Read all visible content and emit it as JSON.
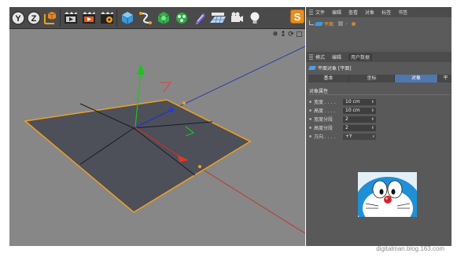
{
  "toolbar": {
    "icons": [
      "y-axis-lock-icon",
      "z-axis-lock-icon",
      "coordinate-system-icon",
      "render-view-icon",
      "render-active-icon",
      "render-settings-icon",
      "cube-primitive-icon",
      "spline-icon",
      "nurbs-icon",
      "modeling-icon",
      "deformer-icon",
      "floor-icon",
      "camera-icon",
      "light-icon"
    ],
    "y_label": "Y",
    "z_label": "Z"
  },
  "viewport": {
    "nav_icons": [
      "✵",
      "↕",
      "⟳",
      "□"
    ]
  },
  "logo": {
    "label": "S"
  },
  "object_manager": {
    "menu": [
      "文件",
      "编辑",
      "查看",
      "对象",
      "标签",
      "书签"
    ],
    "object_name": "平面"
  },
  "attribute_manager": {
    "menu": [
      "模式",
      "编辑",
      "用户数据"
    ],
    "title": "平面对象 [平面]",
    "tabs": [
      "基本",
      "坐标",
      "对象",
      "平"
    ],
    "active_tab": "对象",
    "section": "对象属性",
    "properties": [
      {
        "label": "宽度 . . . .",
        "value": "10 cm"
      },
      {
        "label": "高度 . . . .",
        "value": "10 cm"
      },
      {
        "label": "宽度分段",
        "value": "2"
      },
      {
        "label": "高度分段",
        "value": "2"
      },
      {
        "label": "方向 . . . .",
        "value": "+Y"
      }
    ]
  },
  "watermark": "digitalman.blog.163.com",
  "colors": {
    "viewport_bg": "#878787",
    "plane_fill": "#4d4f59",
    "plane_edge": "#f0a020",
    "accent_blue": "#4e77b0",
    "axis_x": "#d03020",
    "axis_y": "#20c020",
    "axis_z": "#2030d0"
  }
}
